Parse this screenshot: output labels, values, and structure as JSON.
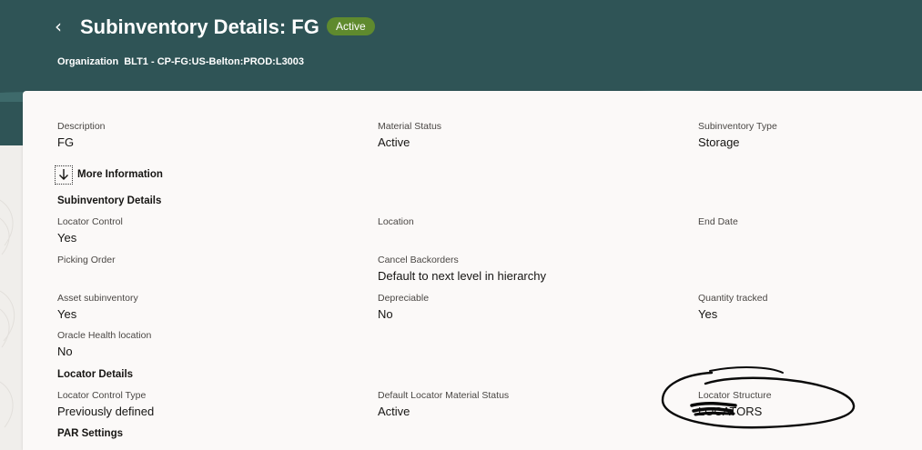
{
  "header": {
    "back_icon": "chevron-left-icon",
    "title": "Subinventory Details: FG",
    "status": "Active",
    "status_color": "#5f8a2e",
    "organization_label": "Organization",
    "organization_value": "BLT1 - CP-FG:US-Belton:PROD:L3003",
    "background_color": "#2f5456"
  },
  "summary": {
    "description": {
      "label": "Description",
      "value": "FG"
    },
    "material_status": {
      "label": "Material Status",
      "value": "Active"
    },
    "subinventory_type": {
      "label": "Subinventory Type",
      "value": "Storage"
    }
  },
  "more_info": {
    "label": "More Information",
    "icon": "chevron-down-icon"
  },
  "subinventory_details": {
    "title": "Subinventory Details",
    "locator_control": {
      "label": "Locator Control",
      "value": "Yes"
    },
    "location": {
      "label": "Location",
      "value": ""
    },
    "end_date": {
      "label": "End Date",
      "value": ""
    },
    "picking_order": {
      "label": "Picking Order",
      "value": ""
    },
    "cancel_backorders": {
      "label": "Cancel Backorders",
      "value": "Default to next level in hierarchy"
    },
    "asset_subinventory": {
      "label": "Asset subinventory",
      "value": "Yes"
    },
    "depreciable": {
      "label": "Depreciable",
      "value": "No"
    },
    "quantity_tracked": {
      "label": "Quantity tracked",
      "value": "Yes"
    },
    "oracle_health_location": {
      "label": "Oracle Health location",
      "value": "No"
    }
  },
  "locator_details": {
    "title": "Locator Details",
    "locator_control_type": {
      "label": "Locator Control Type",
      "value": "Previously defined"
    },
    "default_locator_material_status": {
      "label": "Default Locator Material Status",
      "value": "Active"
    },
    "locator_structure": {
      "label": "Locator Structure",
      "value": "LOCATORS"
    }
  },
  "par_settings": {
    "title": "PAR Settings"
  }
}
